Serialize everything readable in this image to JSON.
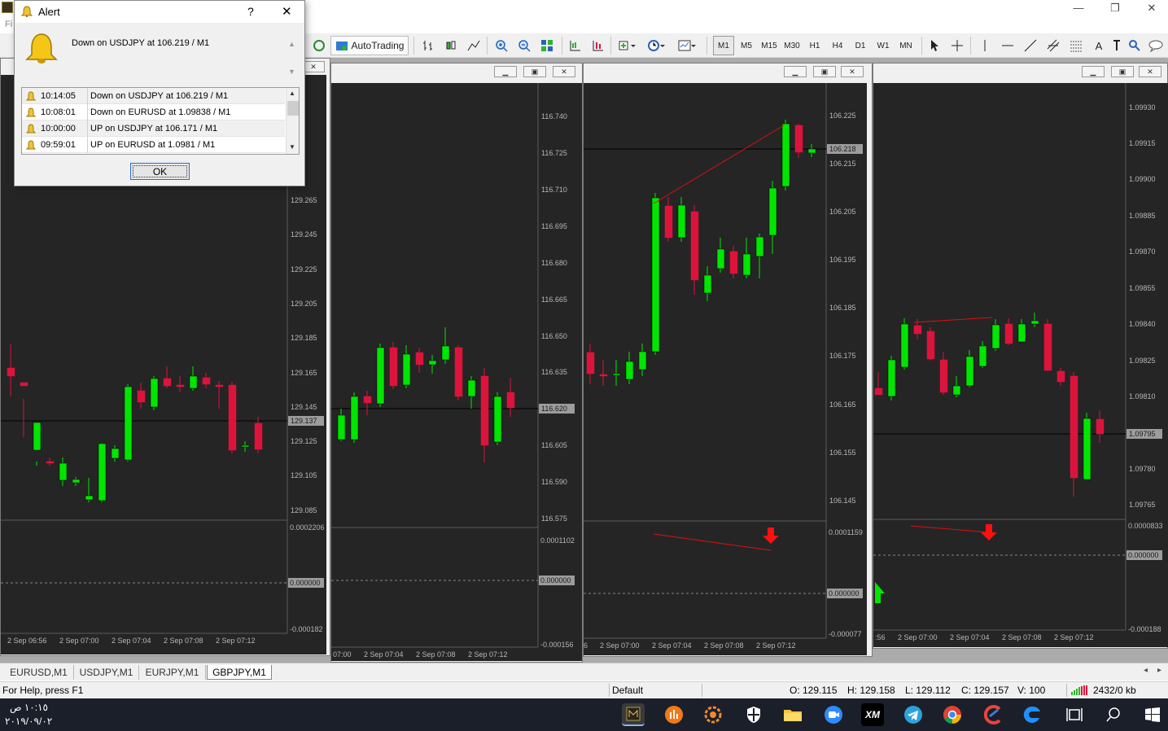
{
  "window": {
    "minimize": "—",
    "restore": "❐",
    "close": "✕",
    "menu_hint": "Fi"
  },
  "toolbar": {
    "autotrading_label": "AutoTrading",
    "timeframes": [
      "M1",
      "M5",
      "M15",
      "M30",
      "H1",
      "H4",
      "D1",
      "W1",
      "MN"
    ],
    "tools": [
      "A"
    ]
  },
  "charts": [
    {
      "prices": [
        "325",
        "305",
        "285",
        "129.265",
        "129.245",
        "129.225",
        "129.205",
        "129.185",
        "129.165",
        "129.145",
        "129.125",
        "129.105",
        "129.085"
      ],
      "current": "129.137",
      "ind": [
        "0.0002206",
        "0.000000",
        "-0.000182"
      ],
      "times": [
        "2 Sep 06:56",
        "2 Sep 07:00",
        "2 Sep 07:04",
        "2 Sep 07:08",
        "2 Sep 07:12"
      ]
    },
    {
      "prices": [
        "116.740",
        "116.725",
        "116.710",
        "116.695",
        "116.680",
        "116.665",
        "116.650",
        "116.635",
        "116.605",
        "116.590",
        "116.575"
      ],
      "current": "116.620",
      "ind": [
        "0.0001102",
        "0.000000",
        "-0.000156"
      ],
      "times": [
        "07:00",
        "2 Sep 07:04",
        "2 Sep 07:08",
        "2 Sep 07:12"
      ]
    },
    {
      "prices": [
        "106.225",
        "106.215",
        "106.205",
        "106.195",
        "106.185",
        "106.175",
        "106.165",
        "106.155",
        "106.145"
      ],
      "current": "106.218",
      "ind": [
        "0.0001159",
        "0.000000",
        "-0.000077"
      ],
      "times": [
        "6",
        "2 Sep 07:00",
        "2 Sep 07:04",
        "2 Sep 07:08",
        "2 Sep 07:12"
      ]
    },
    {
      "prices": [
        "1.09930",
        "1.09915",
        "1.09900",
        "1.09885",
        "1.09870",
        "1.09855",
        "1.09840",
        "1.09825",
        "1.09810",
        "1.09780",
        "1.09765"
      ],
      "current": "1.09795",
      "ind": [
        "0.0000833",
        "0.000000",
        "-0.000188"
      ],
      "times": [
        ":56",
        "2 Sep 07:00",
        "2 Sep 07:04",
        "2 Sep 07:08",
        "2 Sep 07:12"
      ]
    }
  ],
  "tabs": [
    "EURUSD,M1",
    "USDJPY,M1",
    "EURJPY,M1",
    "GBPJPY,M1"
  ],
  "status": {
    "help": "For Help, press F1",
    "profile": "Default",
    "open": "O: 129.115",
    "high": "H: 129.158",
    "low": "L: 129.112",
    "close": "C: 129.157",
    "volume": "V: 100",
    "traffic": "2432/0 kb"
  },
  "taskbar": {
    "time": "١٠:١٥ ص",
    "date": "٢٠١٩/٠٩/٠٢",
    "xm_label": "XM"
  },
  "alert": {
    "title": "Alert",
    "help": "?",
    "close": "✕",
    "message": "Down on USDJPY at 106.219 / M1",
    "rows": [
      {
        "time": "10:14:05",
        "msg": "Down on USDJPY at 106.219 / M1"
      },
      {
        "time": "10:08:01",
        "msg": "Down on EURUSD at 1.09838 / M1"
      },
      {
        "time": "10:00:00",
        "msg": "UP on USDJPY at 106.171 / M1"
      },
      {
        "time": "09:59:01",
        "msg": "UP on EURUSD at 1.0981 / M1"
      }
    ],
    "ok": "OK"
  },
  "colors": {
    "bull": "#00e600",
    "bear": "#dc143c",
    "chart_bg": "#252525",
    "ticks": "#b7b7b7",
    "trendline": "#e01010",
    "arrow": "#ff1010"
  }
}
